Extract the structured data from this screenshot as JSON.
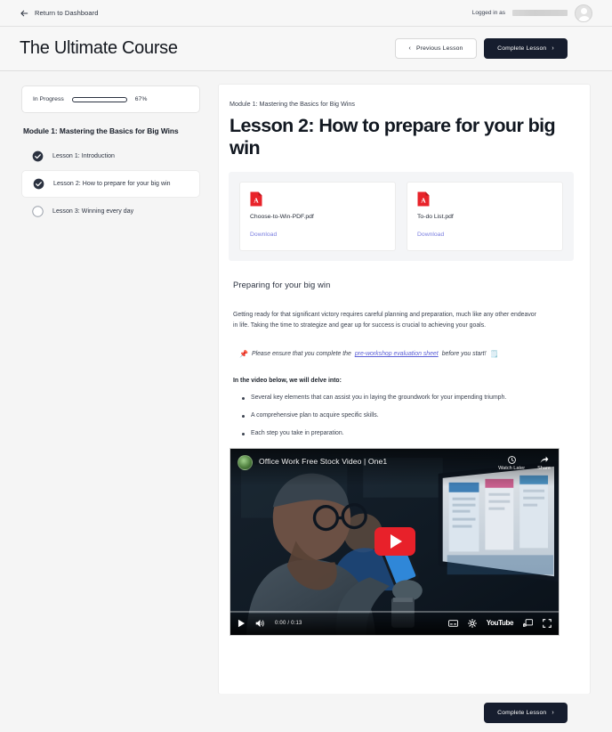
{
  "topbar": {
    "return_label": "Return to Dashboard",
    "back_icon": "arrow-left-icon",
    "logged_in_label": "Logged in as",
    "username_redacted": "",
    "avatar_icon": "user-avatar-icon"
  },
  "header": {
    "course_title": "The Ultimate Course",
    "previous_label": "Previous Lesson",
    "previous_chevron": "‹",
    "complete_label": "Complete Lesson",
    "complete_chevron": "›"
  },
  "sidebar": {
    "progress": {
      "status_label": "In Progress",
      "percent_label": "67%",
      "percent_value": 67,
      "fill_color": "#2b3240"
    },
    "module_title": "Module 1: Mastering the Basics for Big Wins",
    "lessons": [
      {
        "label": "Lesson 1: Introduction",
        "completed": true,
        "active": false
      },
      {
        "label": "Lesson 2: How to prepare for your big win",
        "completed": true,
        "active": true
      },
      {
        "label": "Lesson 3: Winning every day",
        "completed": false,
        "active": false
      }
    ]
  },
  "main": {
    "breadcrumb": "Module 1: Mastering the Basics for Big Wins",
    "lesson_heading": "Lesson 2: How to prepare for your big win",
    "attachments": [
      {
        "filename": "Choose-to-Win-PDF.pdf",
        "download_label": "Download",
        "icon": "pdf-file-icon"
      },
      {
        "filename": "To-do List.pdf",
        "download_label": "Download",
        "icon": "pdf-file-icon"
      }
    ],
    "section_title": "Preparing for your big win",
    "paragraph": "Getting ready for that significant victory requires careful planning and preparation, much like any other endeavor in life. Taking the time to strategize and gear up for success is crucial to achieving your goals.",
    "note": {
      "lead_emoji": "📌",
      "text_before": "Please ensure that you complete the",
      "link_text": "pre-workshop evaluation sheet",
      "text_after": "before you start!",
      "trail_emoji": "🗒️"
    },
    "lead_in": "In the video below, we will delve into:",
    "bullets": [
      "Several key elements that can assist you in laying the groundwork for your impending triumph.",
      "A comprehensive plan to acquire specific skills.",
      "Each step you take in preparation."
    ],
    "video": {
      "title": "Office Work Free Stock Video | One1",
      "watch_later_label": "Watch Later",
      "share_label": "Share",
      "play_icon": "youtube-play-icon",
      "time_display": "0:00 / 0:13",
      "brand": "YouTube",
      "controls": [
        "play-icon",
        "volume-icon",
        "captions-icon",
        "settings-gear-icon",
        "cast-icon",
        "fullscreen-icon"
      ]
    }
  },
  "footer": {
    "complete_label": "Complete Lesson",
    "complete_chevron": "›"
  }
}
